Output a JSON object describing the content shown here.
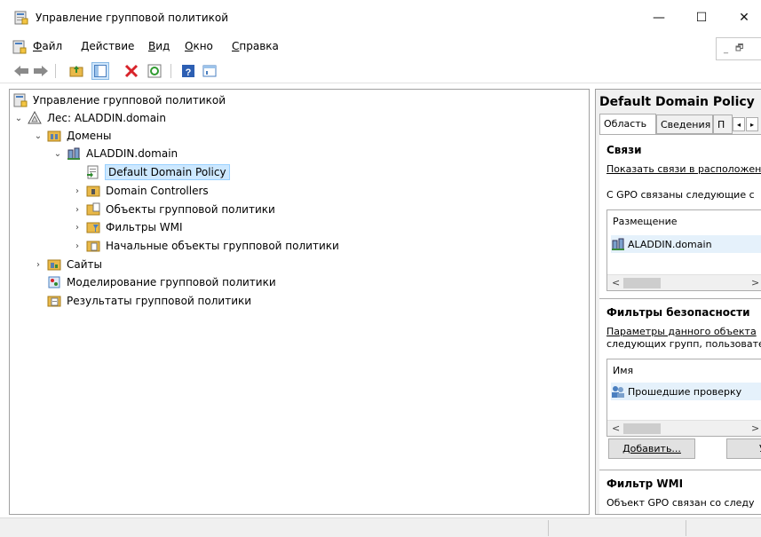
{
  "window": {
    "title": "Управление групповой политикой",
    "controls": {
      "minimize": "—",
      "maximize": "☐",
      "close": "✕"
    }
  },
  "menu": {
    "items": [
      {
        "underline": "Ф",
        "rest": "айл"
      },
      {
        "underline": "Д",
        "rest": "ействие"
      },
      {
        "underline": "В",
        "rest": "ид"
      },
      {
        "underline": "О",
        "rest": "кно"
      },
      {
        "underline": "С",
        "rest": "правка"
      }
    ],
    "mdi": {
      "minimize": "_",
      "restore": "🗗"
    }
  },
  "toolbar": {
    "buttons": [
      "back-icon",
      "forward-icon",
      "up-folder-icon",
      "show-hide-tree-icon",
      "delete-icon",
      "refresh-icon",
      "help-icon",
      "properties-icon"
    ]
  },
  "tree": {
    "nodes": [
      {
        "label": "Управление групповой политикой",
        "chev": "",
        "icon": "gpmc-icon"
      },
      {
        "label": "Лес: ALADDIN.domain",
        "chev": "⌄",
        "icon": "forest-icon"
      },
      {
        "label": "Домены",
        "chev": "⌄",
        "icon": "domains-icon"
      },
      {
        "label": "ALADDIN.domain",
        "chev": "⌄",
        "icon": "domain-icon"
      },
      {
        "label": "Default Domain Policy",
        "chev": "",
        "icon": "gpo-link-icon"
      },
      {
        "label": "Domain Controllers",
        "chev": "›",
        "icon": "ou-icon"
      },
      {
        "label": "Объекты групповой политики",
        "chev": "›",
        "icon": "gpo-folder-icon"
      },
      {
        "label": "Фильтры WMI",
        "chev": "›",
        "icon": "wmi-folder-icon"
      },
      {
        "label": "Начальные объекты групповой политики",
        "chev": "›",
        "icon": "starter-gpo-icon"
      },
      {
        "label": "Сайты",
        "chev": "›",
        "icon": "sites-icon"
      },
      {
        "label": "Моделирование групповой политики",
        "chev": "",
        "icon": "modeling-icon"
      },
      {
        "label": "Результаты групповой политики",
        "chev": "",
        "icon": "results-icon"
      }
    ]
  },
  "details": {
    "title": "Default Domain Policy",
    "tabs": [
      "Область",
      "Сведения",
      "П"
    ],
    "tab_arrows": {
      "left": "◂",
      "right": "▸"
    },
    "links": {
      "heading": "Связи",
      "show_links_label": "Показать связи в расположен",
      "linked_text": "С GPO связаны следующие с",
      "column": "Размещение",
      "row": "ALADDIN.domain"
    },
    "security": {
      "heading": "Фильтры безопасности",
      "text_line1": "Параметры данного объекта",
      "text_line2": "следующих групп, пользовате",
      "column": "Имя",
      "row": "Прошедшие проверку",
      "add_button": "Добавить...",
      "remove_button": "У"
    },
    "wmi": {
      "heading": "Фильтр WMI",
      "text": "Объект GPO связан со следу"
    },
    "scroll": {
      "left": "<",
      "right": ">"
    }
  }
}
